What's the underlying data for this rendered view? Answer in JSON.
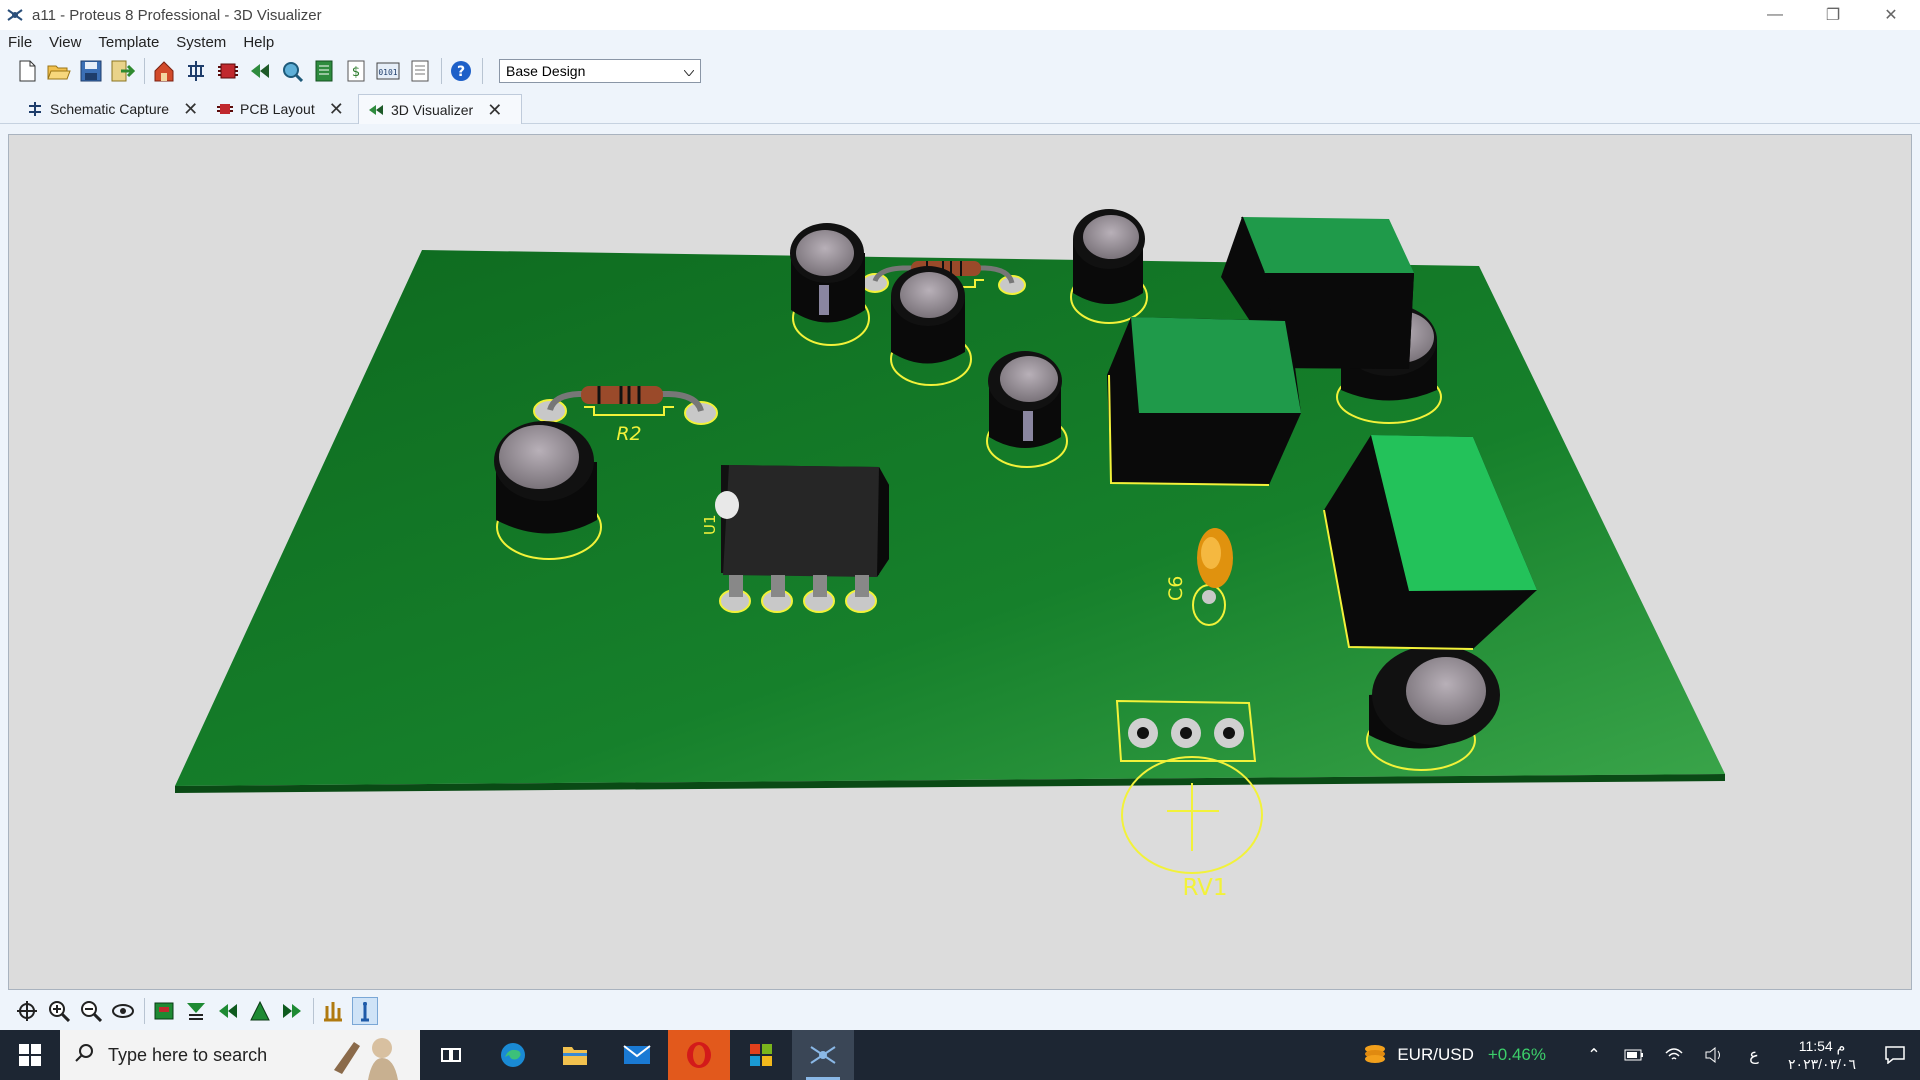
{
  "window": {
    "title": "a11 - Proteus 8 Professional - 3D Visualizer",
    "minimize": "—",
    "restore": "❐",
    "close": "✕"
  },
  "menu": [
    "File",
    "View",
    "Template",
    "System",
    "Help"
  ],
  "toolbar": {
    "icons": [
      "new-file-icon",
      "open-folder-icon",
      "save-icon",
      "import-icon",
      "home-icon",
      "schematic-icon",
      "pcb-icon",
      "3d-view-icon",
      "gerber-icon",
      "bom-icon",
      "design-explorer-icon",
      "code-icon",
      "notes-icon",
      "help-icon"
    ],
    "variant_select": "Base Design"
  },
  "tabs": [
    {
      "label": "Schematic Capture",
      "icon": "schematic-icon",
      "active": false
    },
    {
      "label": "PCB Layout",
      "icon": "pcb-icon",
      "active": false
    },
    {
      "label": "3D Visualizer",
      "icon": "3d-view-icon",
      "active": true
    }
  ],
  "board": {
    "color": "#1a7a2c",
    "silk_color": "#f2f23a",
    "labels": {
      "r2": "R2",
      "u1": "U1",
      "c6": "C6",
      "rv1": "RV1"
    }
  },
  "bottom_toolbar": {
    "icons": [
      "pan-icon",
      "zoom-in-icon",
      "zoom-out-icon",
      "orbit-icon",
      "top-view-icon",
      "front-view-icon",
      "left-view-icon",
      "back-view-icon",
      "right-view-icon",
      "height-icon",
      "info-icon"
    ],
    "active": "info-icon"
  },
  "taskbar": {
    "search_placeholder": "Type here to search",
    "apps": [
      "task-view-icon",
      "edge-icon",
      "file-explorer-icon",
      "mail-icon",
      "opera-icon",
      "windows-store-icon",
      "proteus-icon"
    ],
    "active_app": "proteus-icon",
    "ticker": {
      "pair": "EUR/USD",
      "change": "+0.46%"
    },
    "tray_lang": "ع",
    "time": "11:54 م",
    "date": "٢٠٢٣/٠٣/٠٦"
  }
}
